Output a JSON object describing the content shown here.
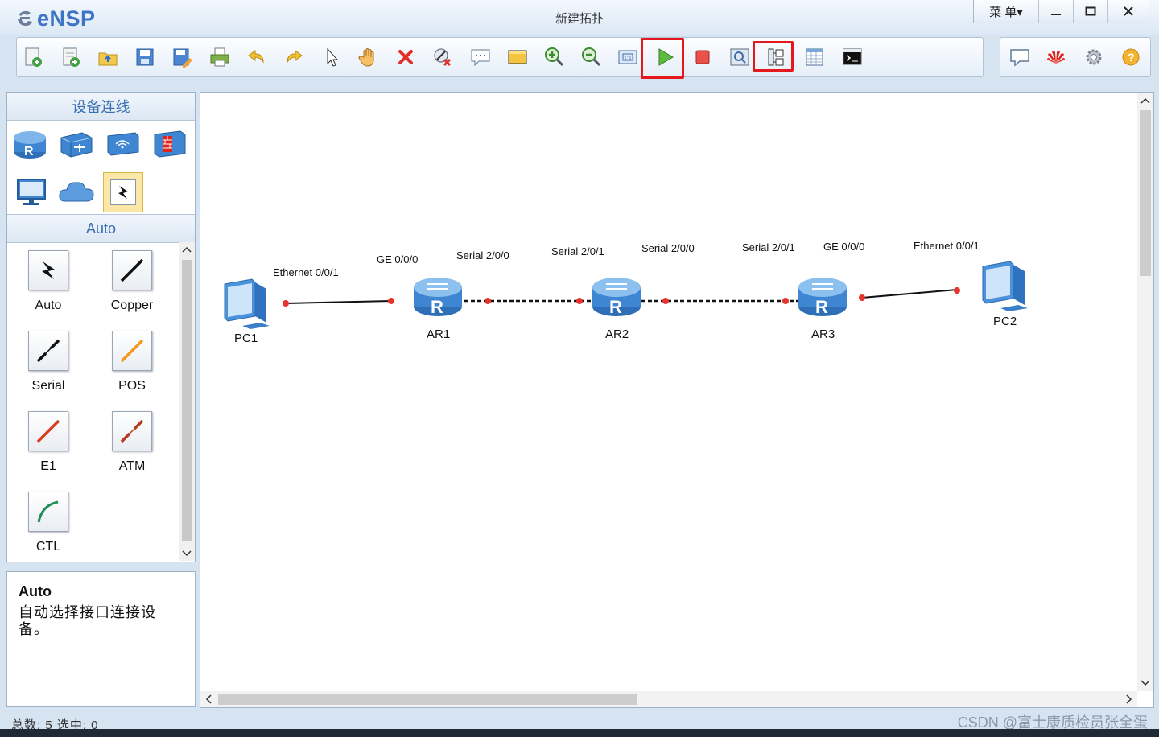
{
  "app": {
    "logo_text": "eNSP",
    "window_title": "新建拓扑",
    "menu_label": "菜 单▾"
  },
  "toolbar": {
    "buttons": [
      {
        "name": "new-topology",
        "icon": "new-doc-icon"
      },
      {
        "name": "new-example",
        "icon": "new-example-icon"
      },
      {
        "name": "open",
        "icon": "open-folder-icon"
      },
      {
        "name": "save",
        "icon": "save-icon"
      },
      {
        "name": "save-as",
        "icon": "save-as-icon"
      },
      {
        "name": "print",
        "icon": "print-icon"
      },
      {
        "name": "undo",
        "icon": "undo-icon"
      },
      {
        "name": "redo",
        "icon": "redo-icon"
      },
      {
        "name": "select",
        "icon": "pointer-icon"
      },
      {
        "name": "drag",
        "icon": "hand-icon"
      },
      {
        "name": "delete",
        "icon": "delete-icon"
      },
      {
        "name": "delete-links",
        "icon": "delete-link-icon"
      },
      {
        "name": "text-note",
        "icon": "note-icon"
      },
      {
        "name": "palette",
        "icon": "palette-icon"
      },
      {
        "name": "zoom-in",
        "icon": "zoom-in-icon"
      },
      {
        "name": "zoom-out",
        "icon": "zoom-out-icon"
      },
      {
        "name": "fit-view",
        "icon": "fit-view-icon"
      },
      {
        "name": "start-device",
        "icon": "play-icon"
      },
      {
        "name": "stop-device",
        "icon": "stop-icon"
      },
      {
        "name": "capture",
        "icon": "capture-icon"
      },
      {
        "name": "topology-view",
        "icon": "topology-icon"
      },
      {
        "name": "grid",
        "icon": "grid-icon"
      },
      {
        "name": "cli",
        "icon": "console-icon"
      }
    ],
    "right_buttons": [
      {
        "name": "forum",
        "icon": "chat-icon"
      },
      {
        "name": "huawei",
        "icon": "huawei-logo-icon"
      },
      {
        "name": "settings",
        "icon": "gear-icon"
      },
      {
        "name": "help",
        "icon": "help-icon"
      }
    ],
    "highlight_color": "#e5191d"
  },
  "left_panel": {
    "title": "设备连线",
    "device_categories": [
      {
        "name": "router",
        "icon": "router-icon"
      },
      {
        "name": "switch",
        "icon": "switch-icon"
      },
      {
        "name": "wireless",
        "icon": "wireless-icon"
      },
      {
        "name": "firewall",
        "icon": "firewall-icon"
      },
      {
        "name": "terminal",
        "icon": "pc-icon"
      },
      {
        "name": "cloud",
        "icon": "cloud-icon"
      },
      {
        "name": "connection",
        "icon": "lightning-icon"
      }
    ],
    "category_label": "Auto",
    "connections": [
      {
        "label": "Auto",
        "color": "#111111"
      },
      {
        "label": "Copper",
        "color": "#111111"
      },
      {
        "label": "Serial",
        "color": "#111111"
      },
      {
        "label": "POS",
        "color": "#f39a1e"
      },
      {
        "label": "E1",
        "color": "#d8401f"
      },
      {
        "label": "ATM",
        "color": "#b73a1c"
      },
      {
        "label": "CTL",
        "color": "#1f8f56"
      }
    ]
  },
  "description": {
    "title": "Auto",
    "text": "自动选择接口连接设备。"
  },
  "topology": {
    "nodes": [
      {
        "id": "PC1",
        "label": "PC1",
        "type": "pc"
      },
      {
        "id": "AR1",
        "label": "AR1",
        "type": "router"
      },
      {
        "id": "AR2",
        "label": "AR2",
        "type": "router"
      },
      {
        "id": "AR3",
        "label": "AR3",
        "type": "router"
      },
      {
        "id": "PC2",
        "label": "PC2",
        "type": "pc"
      }
    ],
    "ports": [
      "Ethernet 0/0/1",
      "GE 0/0/0",
      "Serial 2/0/0",
      "Serial 2/0/1",
      "Serial 2/0/0",
      "Serial 2/0/1",
      "GE 0/0/0",
      "Ethernet 0/0/1"
    ]
  },
  "status": {
    "text": "总数: 5  选中: 0"
  },
  "watermark": "CSDN @富士康质检员张全蛋"
}
